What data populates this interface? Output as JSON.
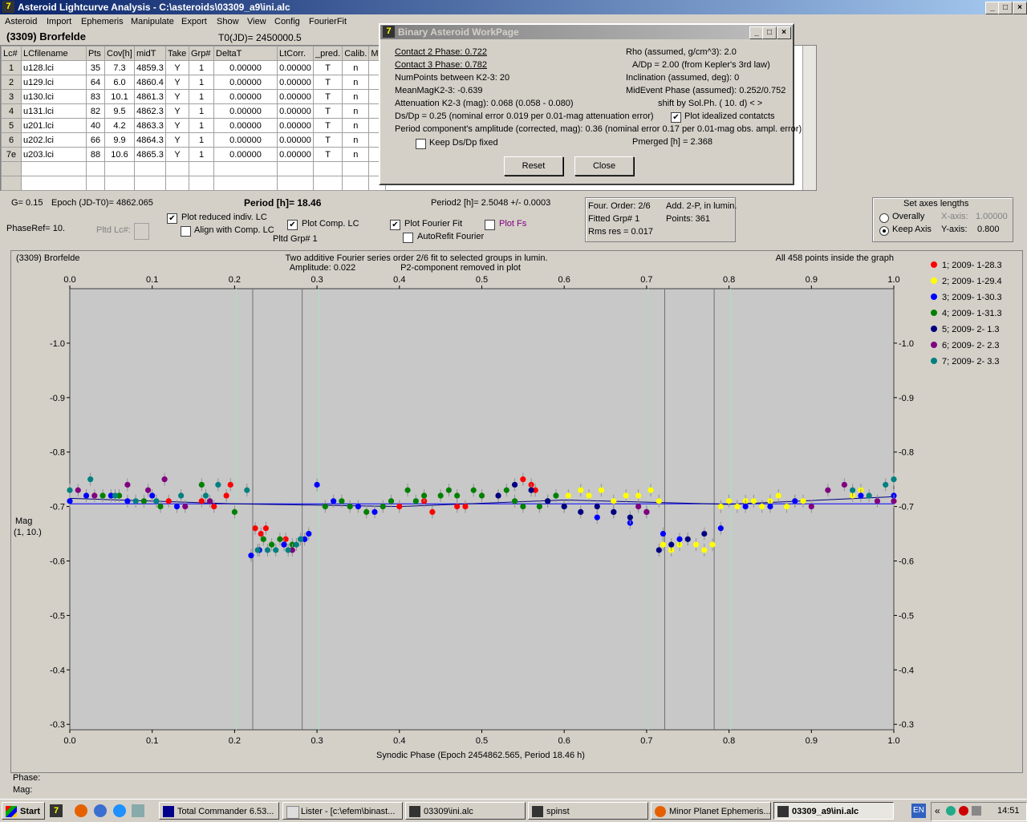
{
  "window": {
    "title": "Asteroid Lightcurve Analysis - C:\\asteroids\\03309_a9\\ini.alc",
    "icon_text": "7",
    "min": "_",
    "max": "□",
    "close": "×"
  },
  "menu": [
    "Asteroid",
    "Import",
    "Ephemeris",
    "Manipulate",
    "Export",
    "Show",
    "View",
    "Config",
    "FourierFit"
  ],
  "header": {
    "object": "(3309) Brorfelde",
    "t0": "T0(JD)= 2450000.5"
  },
  "table": {
    "columns": [
      "Lc#",
      "LCfilename",
      "Pts",
      "Cov[h]",
      "midT",
      "Take",
      "Grp#",
      "DeltaT",
      "LtCorr.",
      "_pred.",
      "Calib.",
      "M"
    ],
    "rows": [
      [
        "1",
        "u128.lci",
        "35",
        "7.3",
        "4859.3",
        "Y",
        "1",
        "0.00000",
        "0.00000",
        "T",
        "n"
      ],
      [
        "2",
        "u129.lci",
        "64",
        "6.0",
        "4860.4",
        "Y",
        "1",
        "0.00000",
        "0.00000",
        "T",
        "n"
      ],
      [
        "3",
        "u130.lci",
        "83",
        "10.1",
        "4861.3",
        "Y",
        "1",
        "0.00000",
        "0.00000",
        "T",
        "n"
      ],
      [
        "4",
        "u131.lci",
        "82",
        "9.5",
        "4862.3",
        "Y",
        "1",
        "0.00000",
        "0.00000",
        "T",
        "n"
      ],
      [
        "5",
        "u201.lci",
        "40",
        "4.2",
        "4863.3",
        "Y",
        "1",
        "0.00000",
        "0.00000",
        "T",
        "n"
      ],
      [
        "6",
        "u202.lci",
        "66",
        "9.9",
        "4864.3",
        "Y",
        "1",
        "0.00000",
        "0.00000",
        "T",
        "n"
      ],
      [
        "7e",
        "u203.lci",
        "88",
        "10.6",
        "4865.3",
        "Y",
        "1",
        "0.00000",
        "0.00000",
        "T",
        "n"
      ]
    ]
  },
  "dialog": {
    "title": "Binary Asteroid WorkPage",
    "contact2": "Contact 2 Phase:   0.722",
    "contact3": "Contact 3 Phase:   0.782",
    "numpoints": "NumPoints between K2-3:    20",
    "meanmag": "MeanMagK2-3:  -0.639",
    "attenuation": "Attenuation K2-3 (mag):  0.068  (0.058 - 0.080)",
    "dsdp": "Ds/Dp = 0.25 (nominal error 0.019 per 0.01-mag attenuation error)",
    "amplitude": "Period component's amplitude (corrected, mag): 0.36 (nominal error 0.17 per 0.01-mag obs. ampl. error)",
    "keep_dsdp": "Keep Ds/Dp fixed",
    "rho": "Rho (assumed, g/cm^3): 2.0",
    "adp": "A/Dp = 2.00 (from Kepler's 3rd law)",
    "inclination": "Inclination (assumed, deg): 0",
    "midevent": "MidEvent Phase (assumed): 0.252/0.752",
    "shift": "shift by Sol.Ph. ( 10. d)   < >",
    "plot_idealized": "Plot idealized contatcts",
    "pmerged": "Pmerged [h] =  2.368",
    "reset": "Reset",
    "close": "Close"
  },
  "controls": {
    "g": "G= 0.15",
    "epoch": "Epoch (JD-T0)= 4862.065",
    "period": "Period [h]= 18.46",
    "period2": "Period2 [h]= 2.5048 +/- 0.0003",
    "phaseref": "PhaseRef= 10.",
    "pltd_lc": "Pltd Lc#:",
    "plot_reduced": "Plot reduced indiv. LC",
    "align_comp": "Align with Comp. LC",
    "plot_comp": "Plot Comp. LC",
    "pltd_grp": "Pltd Grp#  1",
    "plot_fourier": "Plot Fourier Fit",
    "autorefit": "AutoRefit Fourier",
    "plot_fs": "Plot Fs",
    "four_order": "Four. Order:  2/6",
    "add2p": "Add. 2-P, in lumin.",
    "fitted_grp": "Fitted Grp# 1",
    "points": "Points: 361",
    "rms": "Rms res      = 0.017",
    "axes_title": "Set axes lengths",
    "overally": "Overally",
    "keep_axis": "Keep Axis",
    "xaxis_lbl": "X-axis:",
    "xaxis_val": "1.00000",
    "yaxis_lbl": "Y-axis:",
    "yaxis_val": "0.800"
  },
  "graph": {
    "object": "(3309) Brorfelde",
    "desc1": "Two additive Fourier series order 2/6 fit to selected groups in lumin.",
    "desc2": "Amplitude: 0.022",
    "desc3": "P2-component removed in plot",
    "inside": "All 458 points inside the graph",
    "ylabel1": "Mag",
    "ylabel2": "(1, 10.)",
    "xlabel": "Synodic Phase (Epoch 2454862.565, Period 18.46 h)"
  },
  "chart_data": {
    "type": "scatter",
    "xlim": [
      0.0,
      1.0
    ],
    "ylim": [
      -1.1,
      -0.29
    ],
    "y_inverted": true,
    "x_ticks": [
      "0.0",
      "0.1",
      "0.2",
      "0.3",
      "0.4",
      "0.5",
      "0.6",
      "0.7",
      "0.8",
      "0.9",
      "1.0"
    ],
    "y_ticks": [
      "-1.0",
      "-0.9",
      "-0.8",
      "-0.7",
      "-0.6",
      "-0.5",
      "-0.4",
      "-0.3"
    ],
    "vertical_lines_gray": [
      0.222,
      0.282,
      0.722,
      0.782
    ],
    "vertical_lines_green": [
      0.202,
      0.302,
      0.702,
      0.802
    ],
    "legend": [
      {
        "name": "1; 2009- 1-28.3",
        "color": "#ff0000"
      },
      {
        "name": "2; 2009- 1-29.4",
        "color": "#ffff00"
      },
      {
        "name": "3; 2009- 1-30.3",
        "color": "#0000ff"
      },
      {
        "name": "4; 2009- 1-31.3",
        "color": "#008000"
      },
      {
        "name": "5; 2009- 2- 1.3",
        "color": "#000080"
      },
      {
        "name": "6; 2009- 2- 2.3",
        "color": "#800080"
      },
      {
        "name": "7; 2009- 2- 3.3",
        "color": "#008080"
      }
    ],
    "fit_line": {
      "color": "#000080",
      "x": [
        0.0,
        0.2,
        0.4,
        0.6,
        0.8,
        1.0
      ],
      "y": [
        -0.715,
        -0.705,
        -0.7,
        -0.712,
        -0.704,
        -0.718
      ]
    },
    "mean_line": {
      "color": "#0000ff",
      "x": [
        0.0,
        1.0
      ],
      "y": [
        -0.705,
        -0.705
      ]
    },
    "series": [
      {
        "name": "1; 2009- 1-28.3",
        "color": "#ff0000",
        "x": [
          0.12,
          0.16,
          0.175,
          0.19,
          0.195,
          0.225,
          0.232,
          0.238,
          0.26,
          0.262,
          0.4,
          0.43,
          0.44,
          0.47,
          0.48,
          0.56,
          0.565,
          0.55
        ],
        "y": [
          -0.71,
          -0.71,
          -0.7,
          -0.72,
          -0.74,
          -0.66,
          -0.65,
          -0.66,
          -0.63,
          -0.64,
          -0.7,
          -0.71,
          -0.69,
          -0.7,
          -0.7,
          -0.74,
          -0.73,
          -0.75
        ]
      },
      {
        "name": "2; 2009- 1-29.4",
        "color": "#ffff00",
        "x": [
          0.605,
          0.62,
          0.63,
          0.645,
          0.66,
          0.675,
          0.69,
          0.705,
          0.715,
          0.72,
          0.73,
          0.74,
          0.75,
          0.76,
          0.77,
          0.78,
          0.79,
          0.8,
          0.81,
          0.82,
          0.83,
          0.84,
          0.85,
          0.86,
          0.87,
          0.88,
          0.89,
          0.95,
          0.96
        ],
        "y": [
          -0.72,
          -0.73,
          -0.72,
          -0.73,
          -0.71,
          -0.72,
          -0.72,
          -0.73,
          -0.71,
          -0.63,
          -0.62,
          -0.63,
          -0.64,
          -0.63,
          -0.62,
          -0.63,
          -0.7,
          -0.71,
          -0.7,
          -0.71,
          -0.71,
          -0.7,
          -0.71,
          -0.72,
          -0.7,
          -0.71,
          -0.71,
          -0.72,
          -0.73
        ]
      },
      {
        "name": "3; 2009- 1-30.3",
        "color": "#0000ff",
        "x": [
          0.0,
          0.02,
          0.05,
          0.07,
          0.1,
          0.13,
          0.22,
          0.23,
          0.26,
          0.285,
          0.29,
          0.3,
          0.32,
          0.35,
          0.37,
          0.64,
          0.66,
          0.68,
          0.72,
          0.74,
          0.79,
          0.82,
          0.85,
          0.88,
          0.96,
          1.0
        ],
        "y": [
          -0.71,
          -0.72,
          -0.72,
          -0.71,
          -0.72,
          -0.7,
          -0.61,
          -0.62,
          -0.63,
          -0.64,
          -0.65,
          -0.74,
          -0.71,
          -0.7,
          -0.69,
          -0.68,
          -0.69,
          -0.67,
          -0.65,
          -0.64,
          -0.66,
          -0.7,
          -0.7,
          -0.71,
          -0.72,
          -0.72
        ]
      },
      {
        "name": "4; 2009- 1-31.3",
        "color": "#008000",
        "x": [
          0.04,
          0.06,
          0.09,
          0.11,
          0.16,
          0.2,
          0.235,
          0.245,
          0.255,
          0.27,
          0.31,
          0.33,
          0.34,
          0.36,
          0.38,
          0.39,
          0.41,
          0.42,
          0.43,
          0.45,
          0.46,
          0.47,
          0.49,
          0.5,
          0.52,
          0.53,
          0.54,
          0.55,
          0.57,
          0.58,
          0.59,
          0.6
        ],
        "y": [
          -0.72,
          -0.72,
          -0.71,
          -0.7,
          -0.74,
          -0.69,
          -0.64,
          -0.63,
          -0.64,
          -0.63,
          -0.7,
          -0.71,
          -0.7,
          -0.69,
          -0.7,
          -0.71,
          -0.73,
          -0.71,
          -0.72,
          -0.72,
          -0.73,
          -0.72,
          -0.73,
          -0.72,
          -0.72,
          -0.73,
          -0.71,
          -0.7,
          -0.7,
          -0.71,
          -0.72,
          -0.7
        ]
      },
      {
        "name": "5; 2009- 2- 1.3",
        "color": "#000080",
        "x": [
          0.52,
          0.54,
          0.56,
          0.58,
          0.6,
          0.62,
          0.64,
          0.66,
          0.68,
          0.7,
          0.715,
          0.73,
          0.75,
          0.77
        ],
        "y": [
          -0.72,
          -0.74,
          -0.73,
          -0.71,
          -0.7,
          -0.69,
          -0.7,
          -0.69,
          -0.68,
          -0.69,
          -0.62,
          -0.63,
          -0.64,
          -0.65
        ]
      },
      {
        "name": "6; 2009- 2- 2.3",
        "color": "#800080",
        "x": [
          0.01,
          0.03,
          0.07,
          0.095,
          0.115,
          0.14,
          0.17,
          0.27,
          0.69,
          0.7,
          0.9,
          0.92,
          0.94,
          0.98,
          1.0
        ],
        "y": [
          -0.73,
          -0.72,
          -0.74,
          -0.73,
          -0.75,
          -0.7,
          -0.71,
          -0.62,
          -0.7,
          -0.69,
          -0.7,
          -0.73,
          -0.74,
          -0.71,
          -0.71
        ]
      },
      {
        "name": "7; 2009- 2- 3.3",
        "color": "#008080",
        "x": [
          0.0,
          0.025,
          0.055,
          0.08,
          0.105,
          0.135,
          0.165,
          0.18,
          0.215,
          0.228,
          0.24,
          0.25,
          0.265,
          0.275,
          0.28,
          0.95,
          0.97,
          0.99,
          1.0
        ],
        "y": [
          -0.73,
          -0.75,
          -0.72,
          -0.71,
          -0.71,
          -0.72,
          -0.72,
          -0.74,
          -0.73,
          -0.62,
          -0.62,
          -0.62,
          -0.62,
          -0.63,
          -0.64,
          -0.73,
          -0.72,
          -0.74,
          -0.75
        ]
      }
    ]
  },
  "footer": {
    "phase": "Phase:",
    "mag": "Mag:"
  },
  "taskbar": {
    "start": "Start",
    "tasks": [
      "Total Commander 6.53...",
      "Lister - [c:\\efem\\binast...",
      "03309\\ini.alc",
      "spinst",
      "Minor Planet Ephemeris...",
      "03309_a9\\ini.alc"
    ],
    "lang": "EN",
    "clock": "14:51"
  }
}
